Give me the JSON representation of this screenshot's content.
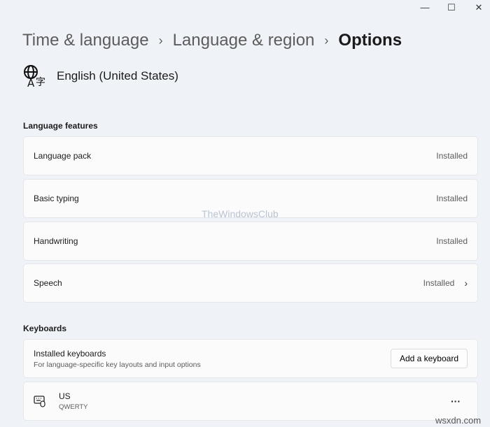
{
  "window": {
    "minimize": "—",
    "maximize": "☐",
    "close": "✕"
  },
  "breadcrumb": [
    "Time & language",
    "Language & region",
    "Options"
  ],
  "language": {
    "name": "English (United States)",
    "icon": "language-icon"
  },
  "language_features": {
    "title": "Language features",
    "items": [
      {
        "label": "Language pack",
        "status": "Installed"
      },
      {
        "label": "Basic typing",
        "status": "Installed"
      },
      {
        "label": "Handwriting",
        "status": "Installed"
      },
      {
        "label": "Speech",
        "status": "Installed"
      }
    ]
  },
  "keyboards": {
    "title": "Keyboards",
    "installed_title": "Installed keyboards",
    "installed_desc": "For language-specific key layouts and input options",
    "add_button": "Add a keyboard",
    "items": [
      {
        "name": "US",
        "layout": "QWERTY",
        "more": "···"
      }
    ]
  },
  "watermarks": [
    "TheWindowsClub",
    "wsxdn.com"
  ]
}
